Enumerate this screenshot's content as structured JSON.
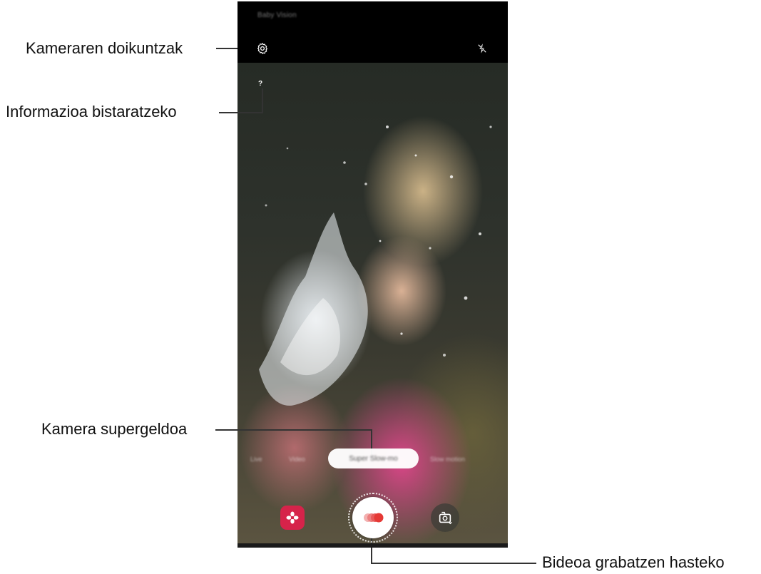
{
  "callouts": {
    "settings": "Kameraren doikuntzak",
    "info": "Informazioa bistaratzeko",
    "mode": "Kamera supergeldoa",
    "record": "Bideoa grabatzen hasteko"
  },
  "camera": {
    "mode_title": "Baby Vision",
    "help_symbol": "?",
    "modes": [
      "Live",
      "Video",
      "Super Slow-mo",
      "Slow motion"
    ],
    "selected_mode": "Super Slow-mo"
  },
  "colors": {
    "effects_button": "#d6234a",
    "record_dot": "#e53935",
    "topbar": "#000000"
  },
  "icons": {
    "settings": "gear-icon",
    "flash": "flash-off-icon",
    "help": "question-icon",
    "effects": "flower-icon",
    "record": "super-slow-record-icon",
    "switch_camera": "switch-camera-icon"
  }
}
